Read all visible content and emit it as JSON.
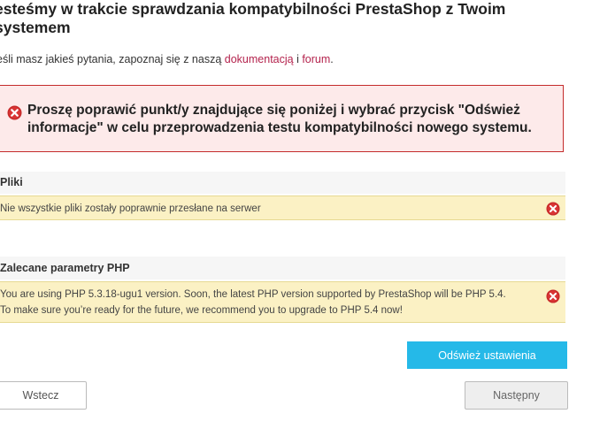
{
  "header": {
    "title": "Sprawdzamy jesteśmy w trakcie sprawdzania kompatybilności PrestaShop z Twoim systemem",
    "title_visible": "esteśmy w trakcie sprawdzania kompatybilności PrestaShop z Twoim systemem"
  },
  "help": {
    "prefix": "eśli masz jakieś pytania, zapoznaj się z naszą ",
    "doc_link": "dokumentacją",
    "joiner": " i ",
    "forum_link": "forum",
    "suffix": "."
  },
  "alert": {
    "icon": "error-icon",
    "message": "Proszę poprawić punkt/y znajdujące się poniżej i wybrać przycisk \"Odśwież informacje\" w celu przeprowadzenia testu kompatybilności nowego systemu."
  },
  "sections": [
    {
      "title": "Pliki",
      "items": [
        {
          "text": "Nie wszystkie pliki zostały poprawnie przesłane na serwer",
          "icon": "error-icon"
        }
      ]
    },
    {
      "title": "Zalecane parametry PHP",
      "items": [
        {
          "text": "You are using PHP 5.3.18-ugu1 version. Soon, the latest PHP version supported by PrestaShop will be PHP 5.4.",
          "text2": "To make sure you’re ready for the future, we recommend you to upgrade to PHP 5.4 now!",
          "icon": "error-icon"
        }
      ]
    }
  ],
  "buttons": {
    "refresh": "Odśwież ustawienia",
    "back": "Wstecz",
    "next": "Następny"
  },
  "colors": {
    "accent": "#25b9e8",
    "link": "#b4234d",
    "error": "#c42c2c",
    "alert_bg": "#fdeaea",
    "warning_bg": "#fbf1c4"
  }
}
